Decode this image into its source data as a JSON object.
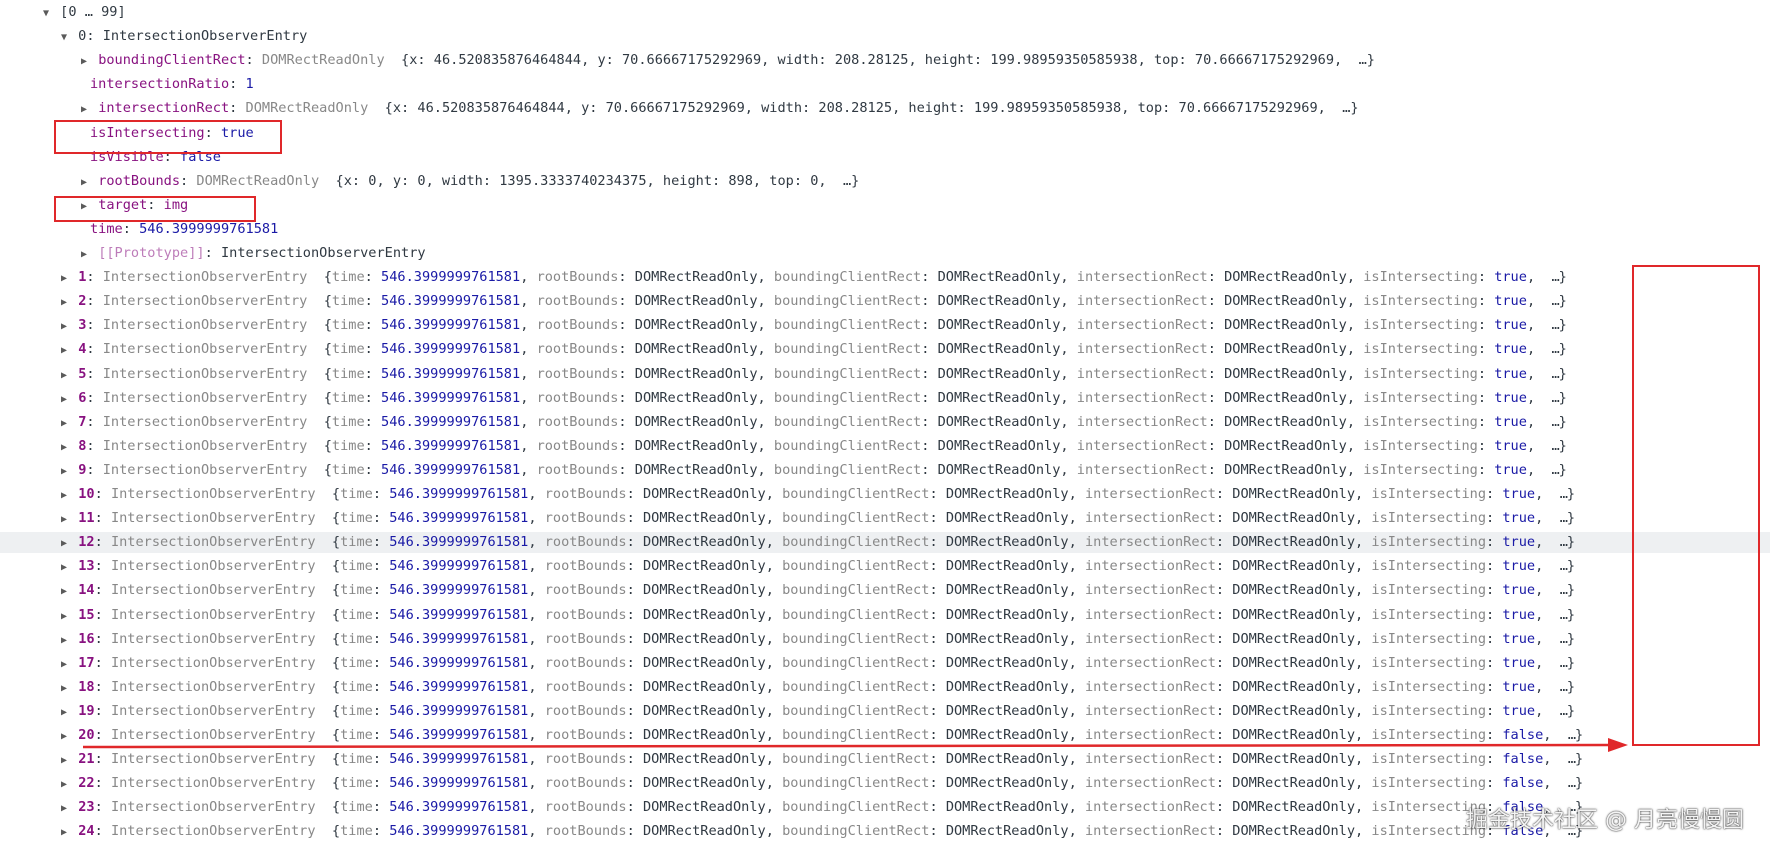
{
  "console": {
    "root_label": "[0 … 99]",
    "entry0": {
      "header": "0: IntersectionObserverEntry",
      "props": [
        {
          "type": "expandable",
          "key": "boundingClientRect",
          "value": "DOMRectReadOnly",
          "preview": "{x: 46.520835876464844, y: 70.66667175292969, width: 208.28125, height: 199.98959350585938, top: 70.66667175292969,  …}"
        },
        {
          "type": "plain",
          "key": "intersectionRatio",
          "value": "1"
        },
        {
          "type": "expandable",
          "key": "intersectionRect",
          "value": "DOMRectReadOnly",
          "preview": "{x: 46.520835876464844, y: 70.66667175292969, width: 208.28125, height: 199.98959350585938, top: 70.66667175292969,  …}"
        },
        {
          "type": "plain",
          "key": "isIntersecting",
          "value": "true"
        },
        {
          "type": "plain",
          "key": "isVisible",
          "value": "false"
        },
        {
          "type": "expandable",
          "key": "rootBounds",
          "value": "DOMRectReadOnly",
          "preview": "{x: 0, y: 0, width: 1395.3333740234375, height: 898, top: 0,  …}"
        },
        {
          "type": "expandable",
          "key": "target",
          "value": "img"
        },
        {
          "type": "plain",
          "key": "time",
          "value": "546.3999999761581"
        },
        {
          "type": "expandable",
          "key": "[[Prototype]]",
          "value": "IntersectionObserverEntry"
        }
      ]
    },
    "summary_common": {
      "class_name": "IntersectionObserverEntry",
      "time_key": "time",
      "time_value": "546.3999999761581",
      "root_bounds_key": "rootBounds",
      "bcr_key": "boundingClientRect",
      "ir_key": "intersectionRect",
      "rect_type": "DOMRectReadOnly",
      "is_intersecting_key": "isIntersecting",
      "ellipsis": "…}"
    },
    "entries": [
      {
        "index": "1",
        "is_intersecting": "true"
      },
      {
        "index": "2",
        "is_intersecting": "true"
      },
      {
        "index": "3",
        "is_intersecting": "true"
      },
      {
        "index": "4",
        "is_intersecting": "true"
      },
      {
        "index": "5",
        "is_intersecting": "true"
      },
      {
        "index": "6",
        "is_intersecting": "true"
      },
      {
        "index": "7",
        "is_intersecting": "true"
      },
      {
        "index": "8",
        "is_intersecting": "true"
      },
      {
        "index": "9",
        "is_intersecting": "true"
      },
      {
        "index": "10",
        "is_intersecting": "true"
      },
      {
        "index": "11",
        "is_intersecting": "true"
      },
      {
        "index": "12",
        "is_intersecting": "true",
        "hovered": true
      },
      {
        "index": "13",
        "is_intersecting": "true"
      },
      {
        "index": "14",
        "is_intersecting": "true"
      },
      {
        "index": "15",
        "is_intersecting": "true"
      },
      {
        "index": "16",
        "is_intersecting": "true"
      },
      {
        "index": "17",
        "is_intersecting": "true"
      },
      {
        "index": "18",
        "is_intersecting": "true"
      },
      {
        "index": "19",
        "is_intersecting": "true"
      },
      {
        "index": "20",
        "is_intersecting": "false"
      },
      {
        "index": "21",
        "is_intersecting": "false"
      },
      {
        "index": "22",
        "is_intersecting": "false"
      },
      {
        "index": "23",
        "is_intersecting": "false"
      },
      {
        "index": "24",
        "is_intersecting": "false"
      }
    ]
  },
  "annotation_color": "#e0282a",
  "watermark": "掘金技术社区 @ 月亮慢慢圆"
}
